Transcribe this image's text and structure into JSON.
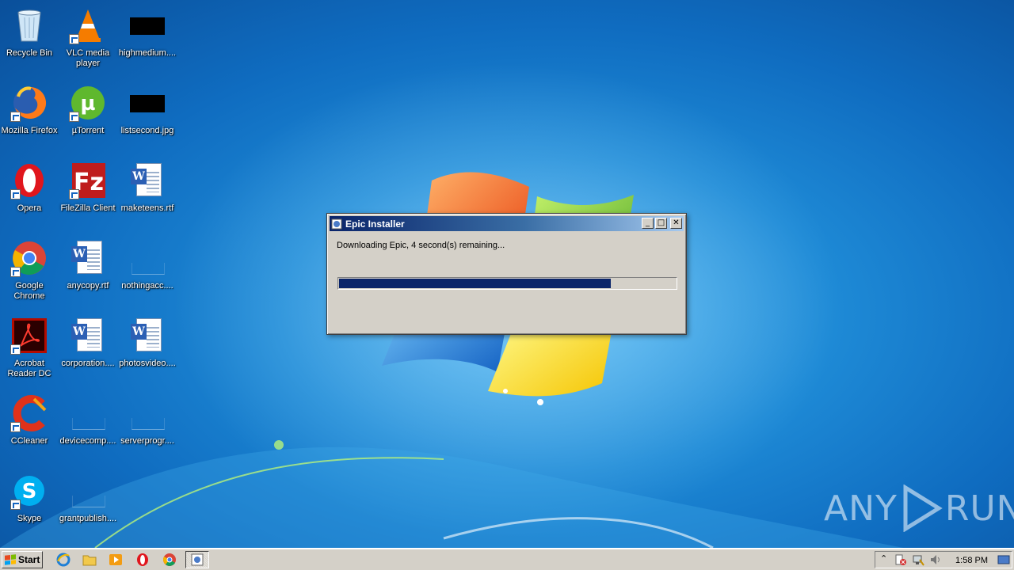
{
  "desktop": {
    "icons": [
      {
        "label": "Recycle Bin"
      },
      {
        "label": "VLC media player"
      },
      {
        "label": "highmedium...."
      },
      {
        "label": "Mozilla Firefox"
      },
      {
        "label": "µTorrent"
      },
      {
        "label": "listsecond.jpg"
      },
      {
        "label": "Opera"
      },
      {
        "label": "FileZilla Client"
      },
      {
        "label": "maketeens.rtf"
      },
      {
        "label": "Google Chrome"
      },
      {
        "label": "anycopy.rtf"
      },
      {
        "label": "nothingacc...."
      },
      {
        "label": "Acrobat Reader DC"
      },
      {
        "label": "corporation...."
      },
      {
        "label": "photosvideo...."
      },
      {
        "label": "CCleaner"
      },
      {
        "label": "devicecomp...."
      },
      {
        "label": "serverprogr...."
      },
      {
        "label": "Skype"
      },
      {
        "label": "grantpublish...."
      }
    ]
  },
  "installer": {
    "title": "Epic Installer",
    "status": "Downloading Epic, 4 second(s) remaining...",
    "progress_fraction": 0.806,
    "buttons": {
      "minimize": "_",
      "maximize": "□",
      "close": "✕"
    }
  },
  "taskbar": {
    "start_label": "Start",
    "clock": "1:58 PM",
    "quick_launch": [
      "ie-icon",
      "folder-icon",
      "media-player-icon",
      "opera-icon",
      "chrome-icon"
    ],
    "tray_icons": [
      "show-hidden-icons-icon",
      "action-center-icon",
      "network-icon",
      "volume-icon"
    ]
  },
  "watermark": {
    "left": "ANY",
    "right": "RUN"
  }
}
